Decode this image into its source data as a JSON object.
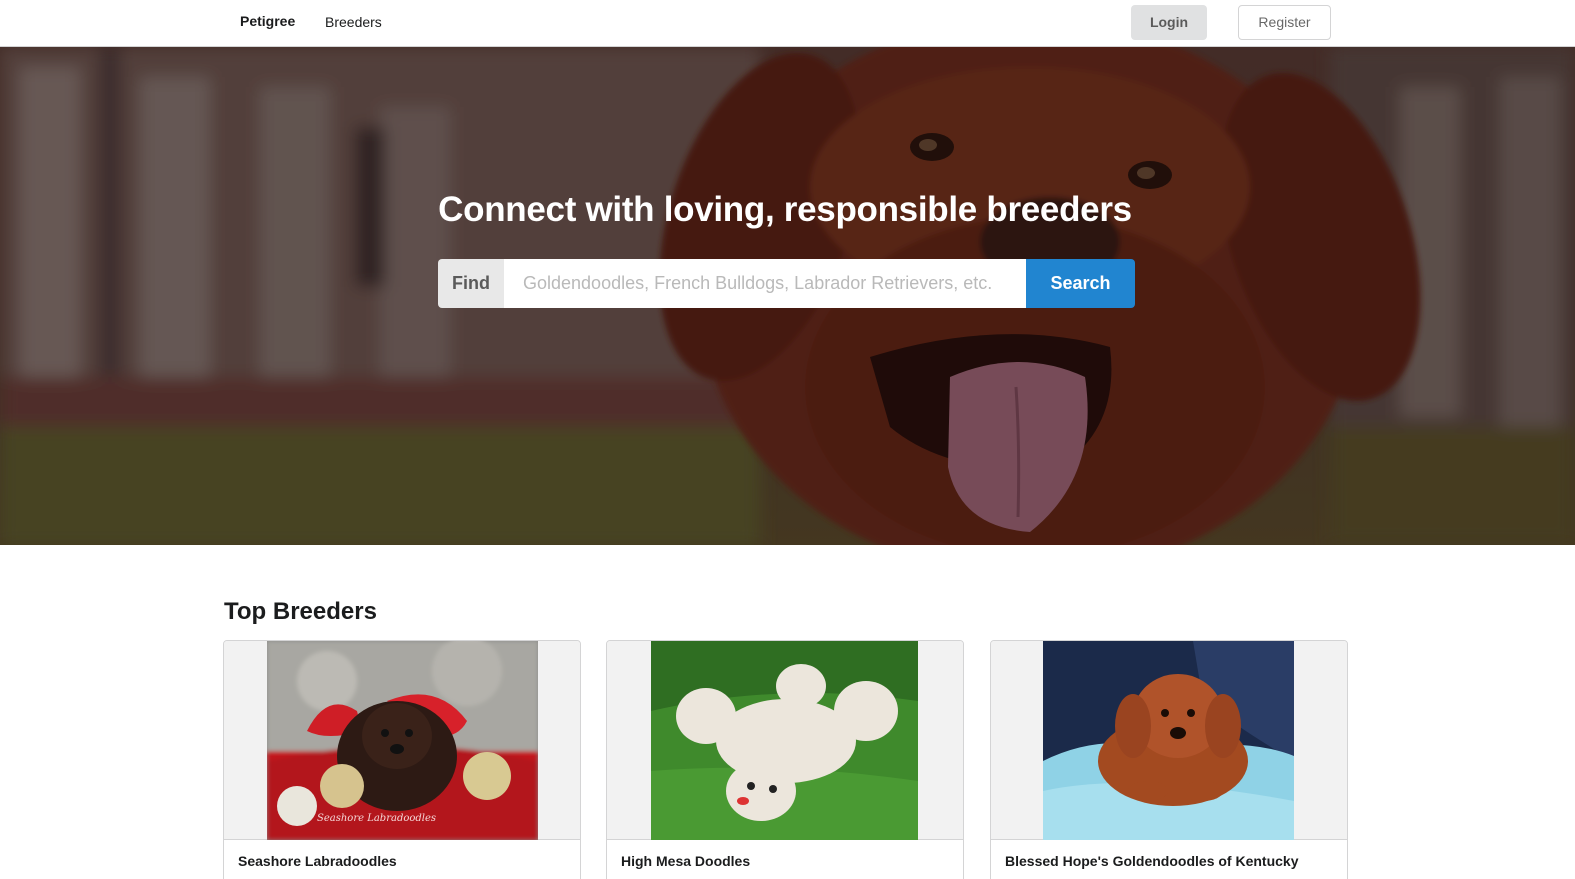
{
  "nav": {
    "brand": "Petigree",
    "links": [
      "Breeders"
    ],
    "login_label": "Login",
    "register_label": "Register"
  },
  "hero": {
    "title": "Connect with loving, responsible breeders",
    "search": {
      "label": "Find",
      "placeholder": "Goldendoodles, French Bulldogs, Labrador Retrievers, etc.",
      "button_label": "Search"
    }
  },
  "top_breeders": {
    "title": "Top Breeders",
    "cards": [
      {
        "name": "Seashore Labradoodles",
        "photo": "chocolate-puppy-with-christmas-ornaments",
        "watermark": "Seashore Labradoodles"
      },
      {
        "name": "High Mesa Doodles",
        "photo": "white-puppy-on-grass"
      },
      {
        "name": "Blessed Hope's Goldendoodles of Kentucky",
        "photo": "red-puppy-on-blue-blanket"
      }
    ]
  },
  "colors": {
    "primary": "#2185d0",
    "login_bg": "#e0e1e2",
    "border": "#d4d4d5"
  }
}
